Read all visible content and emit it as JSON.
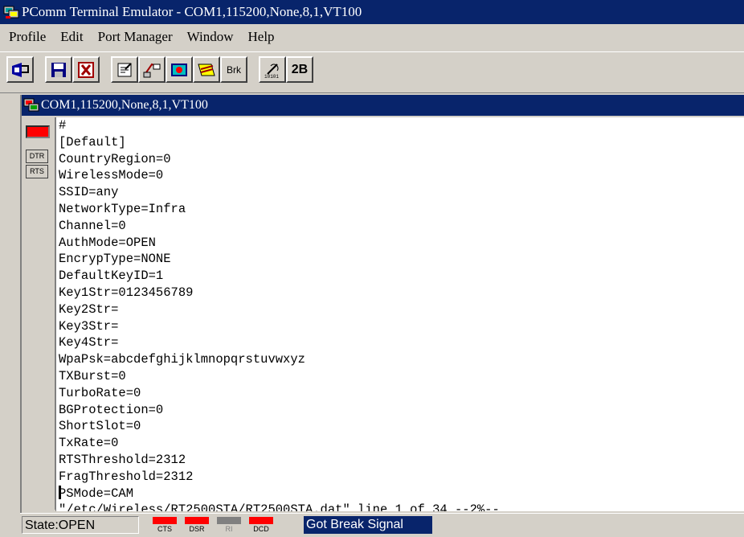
{
  "app": {
    "title": "PComm Terminal Emulator - COM1,115200,None,8,1,VT100"
  },
  "menu": [
    {
      "label": "Profile"
    },
    {
      "label": "Edit"
    },
    {
      "label": "Port Manager"
    },
    {
      "label": "Window"
    },
    {
      "label": "Help"
    }
  ],
  "toolbar": {
    "buttons": [
      {
        "icon": "open-port-icon"
      },
      {
        "icon": "save-icon"
      },
      {
        "icon": "exit-icon"
      },
      {
        "icon": "properties-icon"
      },
      {
        "icon": "transfer-icon"
      },
      {
        "icon": "capture-icon"
      },
      {
        "icon": "send-file-icon"
      },
      {
        "icon": "break-icon",
        "label": "Brk"
      },
      {
        "icon": "binary-icon"
      },
      {
        "icon": "two-byte-icon",
        "label": "2B"
      }
    ]
  },
  "session": {
    "title": "COM1,115200,None,8,1,VT100",
    "dtr_label": "DTR",
    "rts_label": "RTS"
  },
  "terminal": {
    "lines": [
      "#",
      "[Default]",
      "CountryRegion=0",
      "WirelessMode=0",
      "SSID=any",
      "NetworkType=Infra",
      "Channel=0",
      "AuthMode=OPEN",
      "EncrypType=NONE",
      "DefaultKeyID=1",
      "Key1Str=0123456789",
      "Key2Str=",
      "Key3Str=",
      "Key4Str=",
      "WpaPsk=abcdefghijklmnopqrstuvwxyz",
      "TXBurst=0",
      "TurboRate=0",
      "BGProtection=0",
      "ShortSlot=0",
      "TxRate=0",
      "RTSThreshold=2312",
      "FragThreshold=2312",
      "PSMode=CAM",
      "\"/etc/Wireless/RT2500STA/RT2500STA.dat\" line 1 of 34 --2%--"
    ]
  },
  "status": {
    "state": "State:OPEN",
    "signals": [
      {
        "label": "CTS",
        "color": "#ff0000"
      },
      {
        "label": "DSR",
        "color": "#ff0000"
      },
      {
        "label": "RI",
        "color": "#808080"
      },
      {
        "label": "DCD",
        "color": "#ff0000"
      }
    ],
    "message": "Got Break Signal"
  }
}
